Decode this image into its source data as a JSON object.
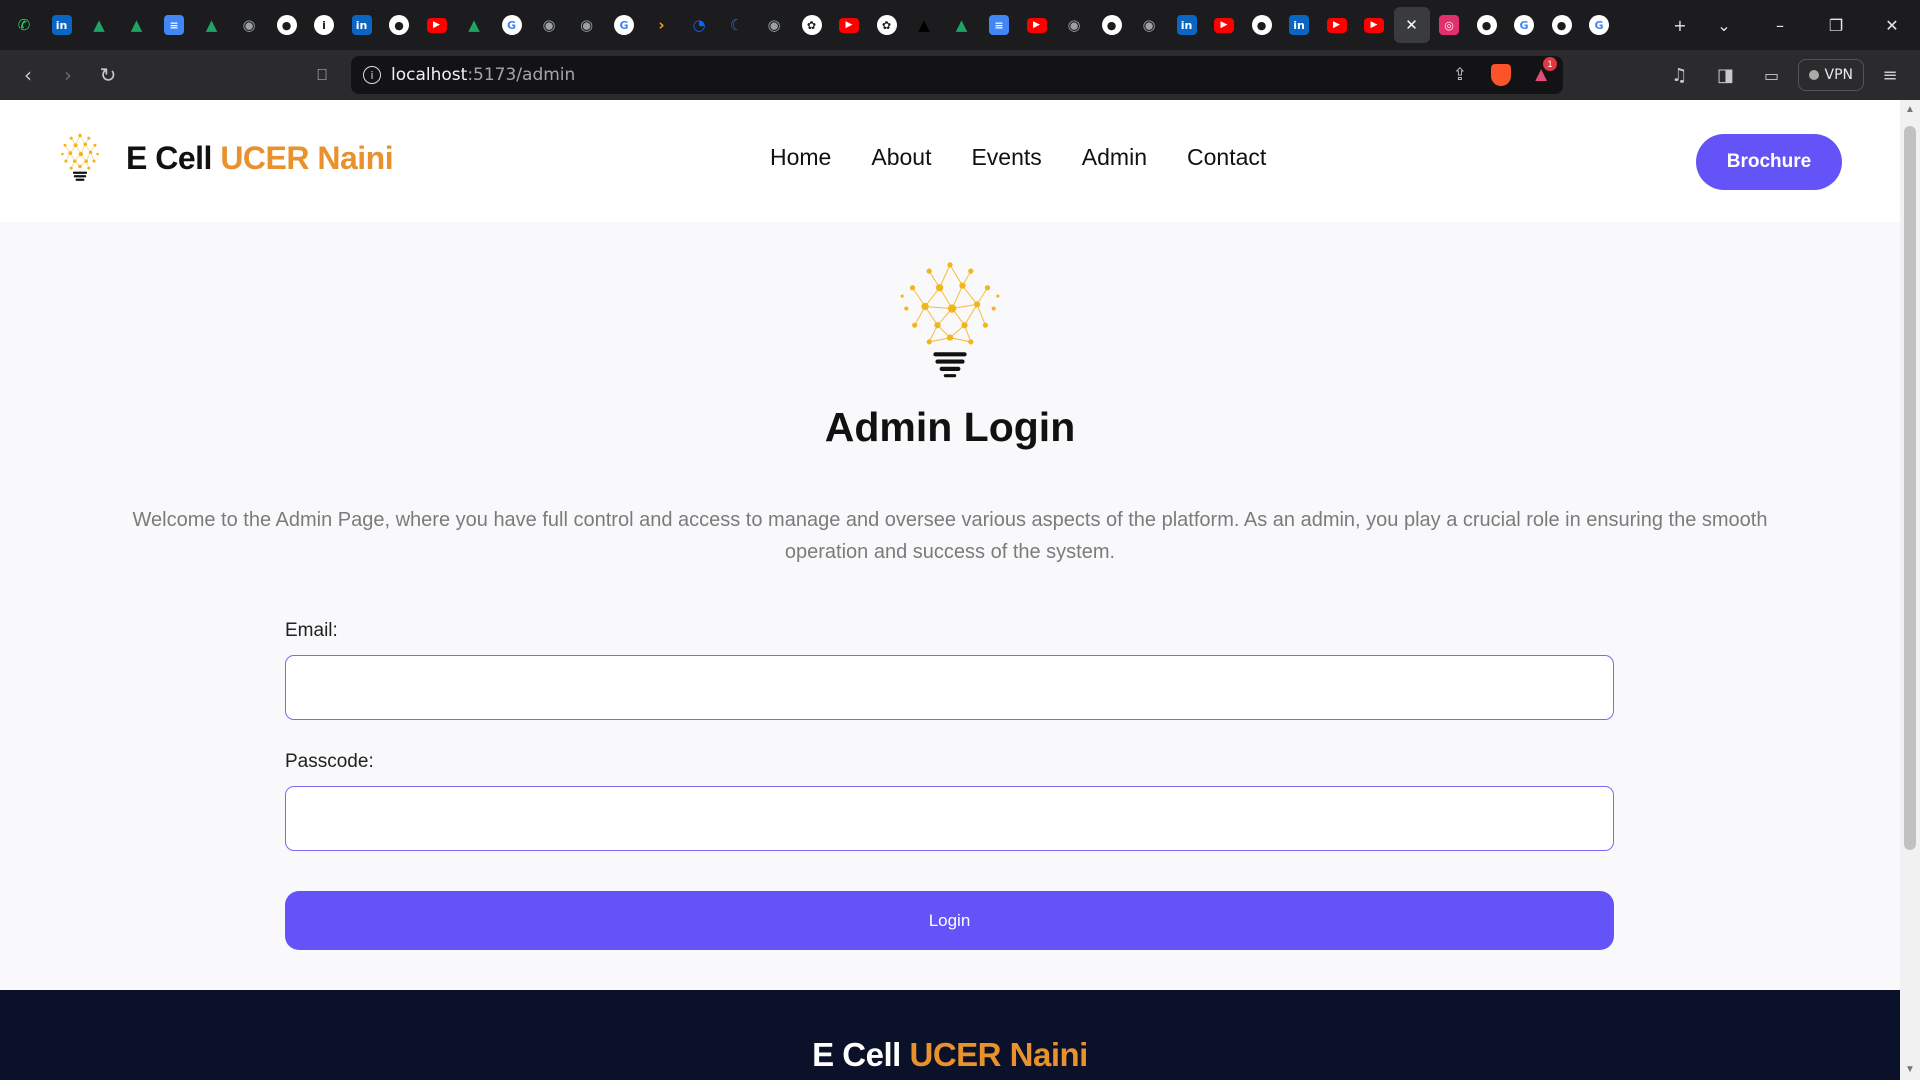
{
  "browser": {
    "tabs": [
      {
        "icon": "whatsapp-icon",
        "color": "#25d366",
        "glyph": "✆"
      },
      {
        "icon": "linkedin-icon",
        "color": "#0a66c2",
        "glyph": "in"
      },
      {
        "icon": "google-drive-icon",
        "color": "#1fa463",
        "glyph": "▲"
      },
      {
        "icon": "google-drive-icon",
        "color": "#1fa463",
        "glyph": "▲"
      },
      {
        "icon": "google-docs-icon",
        "color": "#4285f4",
        "glyph": "≡"
      },
      {
        "icon": "google-drive-icon",
        "color": "#1fa463",
        "glyph": "▲"
      },
      {
        "icon": "globe-icon",
        "color": "#9aa0a6",
        "glyph": "◉"
      },
      {
        "icon": "github-icon",
        "color": "#ffffff",
        "glyph": "●"
      },
      {
        "icon": "info-icon",
        "color": "#ffffff",
        "glyph": "i"
      },
      {
        "icon": "linkedin-icon",
        "color": "#0a66c2",
        "glyph": "in"
      },
      {
        "icon": "github-icon",
        "color": "#ffffff",
        "glyph": "●"
      },
      {
        "icon": "youtube-icon",
        "color": "#ff0000",
        "glyph": "▶"
      },
      {
        "icon": "google-drive-icon",
        "color": "#1fa463",
        "glyph": "▲"
      },
      {
        "icon": "google-icon",
        "color": "#ffffff",
        "glyph": "G"
      },
      {
        "icon": "globe-icon",
        "color": "#9aa0a6",
        "glyph": "◉"
      },
      {
        "icon": "globe-icon",
        "color": "#9aa0a6",
        "glyph": "◉"
      },
      {
        "icon": "google-icon",
        "color": "#ffffff",
        "glyph": "G"
      },
      {
        "icon": "arrow-icon",
        "color": "#f5a623",
        "glyph": "›"
      },
      {
        "icon": "messenger-icon",
        "color": "#0866ff",
        "glyph": "◔"
      },
      {
        "icon": "app-icon",
        "color": "#1a73e8",
        "glyph": "☾"
      },
      {
        "icon": "globe-icon",
        "color": "#9aa0a6",
        "glyph": "◉"
      },
      {
        "icon": "chatgpt-icon",
        "color": "#ffffff",
        "glyph": "✿"
      },
      {
        "icon": "youtube-icon",
        "color": "#ff0000",
        "glyph": "▶"
      },
      {
        "icon": "chatgpt-icon",
        "color": "#ffffff",
        "glyph": "✿"
      },
      {
        "icon": "triangle-icon",
        "color": "#000000",
        "glyph": "▲"
      },
      {
        "icon": "google-drive-icon",
        "color": "#1fa463",
        "glyph": "▲"
      },
      {
        "icon": "google-docs-icon",
        "color": "#4285f4",
        "glyph": "≡"
      },
      {
        "icon": "youtube-icon",
        "color": "#ff0000",
        "glyph": "▶"
      },
      {
        "icon": "globe-icon",
        "color": "#9aa0a6",
        "glyph": "◉"
      },
      {
        "icon": "github-icon",
        "color": "#ffffff",
        "glyph": "●"
      },
      {
        "icon": "globe-icon",
        "color": "#9aa0a6",
        "glyph": "◉"
      },
      {
        "icon": "linkedin-icon",
        "color": "#0a66c2",
        "glyph": "in"
      },
      {
        "icon": "youtube-icon",
        "color": "#ff0000",
        "glyph": "▶"
      },
      {
        "icon": "github-icon",
        "color": "#ffffff",
        "glyph": "●"
      },
      {
        "icon": "linkedin-icon",
        "color": "#0a66c2",
        "glyph": "in"
      },
      {
        "icon": "youtube-icon",
        "color": "#ff0000",
        "glyph": "▶"
      },
      {
        "icon": "youtube-icon",
        "color": "#ff0000",
        "glyph": "▶"
      },
      {
        "icon": "close-icon",
        "color": "#ffffff",
        "glyph": "✕",
        "active": true
      },
      {
        "icon": "instagram-icon",
        "color": "#e1306c",
        "glyph": "◎"
      },
      {
        "icon": "github-icon",
        "color": "#ffffff",
        "glyph": "●"
      },
      {
        "icon": "google-icon",
        "color": "#ffffff",
        "glyph": "G"
      },
      {
        "icon": "github-icon",
        "color": "#ffffff",
        "glyph": "●"
      },
      {
        "icon": "google-icon",
        "color": "#ffffff",
        "glyph": "G"
      }
    ],
    "url_host": "localhost",
    "url_rest": ":5173/admin",
    "notification_count": "1",
    "vpn_label": "VPN"
  },
  "site": {
    "brand_part1": "E Cell",
    "brand_part2": "UCER Naini",
    "nav": [
      "Home",
      "About",
      "Events",
      "Admin",
      "Contact"
    ],
    "brochure_label": "Brochure",
    "accent": "#6453f7",
    "brand_orange": "#e8912d"
  },
  "login": {
    "title": "Admin Login",
    "intro": "Welcome to the Admin Page, where you have full control and access to manage and oversee various aspects of the platform. As an admin, you play a crucial role in ensuring the smooth operation and success of the system.",
    "email_label": "Email:",
    "email_value": "",
    "passcode_label": "Passcode:",
    "passcode_value": "",
    "button_label": "Login"
  },
  "footer": {
    "brand_part1": "E Cell",
    "brand_part2": "UCER Naini"
  }
}
